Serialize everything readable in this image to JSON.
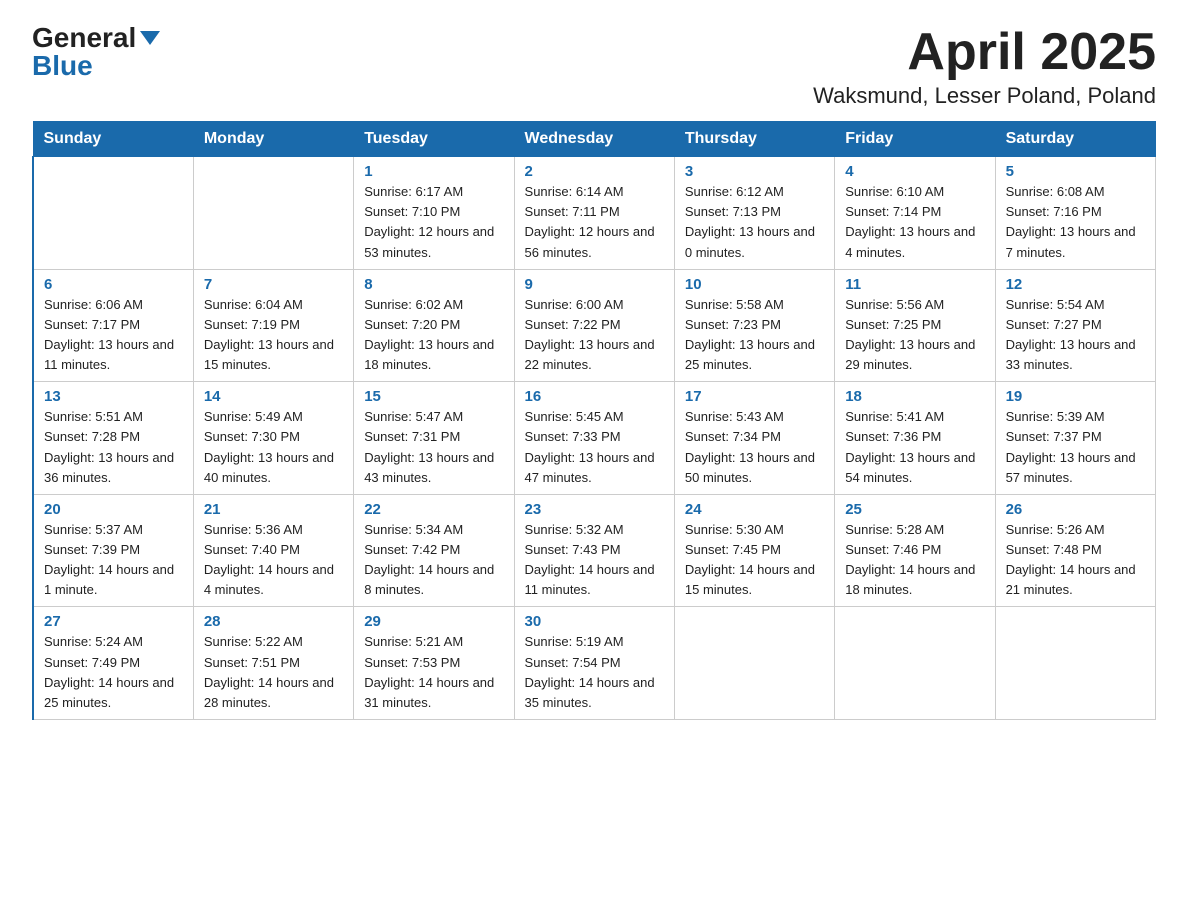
{
  "header": {
    "logo_general": "General",
    "logo_blue": "Blue",
    "title": "April 2025",
    "subtitle": "Waksmund, Lesser Poland, Poland"
  },
  "days_of_week": [
    "Sunday",
    "Monday",
    "Tuesday",
    "Wednesday",
    "Thursday",
    "Friday",
    "Saturday"
  ],
  "weeks": [
    [
      {
        "day": "",
        "sunrise": "",
        "sunset": "",
        "daylight": ""
      },
      {
        "day": "",
        "sunrise": "",
        "sunset": "",
        "daylight": ""
      },
      {
        "day": "1",
        "sunrise": "Sunrise: 6:17 AM",
        "sunset": "Sunset: 7:10 PM",
        "daylight": "Daylight: 12 hours and 53 minutes."
      },
      {
        "day": "2",
        "sunrise": "Sunrise: 6:14 AM",
        "sunset": "Sunset: 7:11 PM",
        "daylight": "Daylight: 12 hours and 56 minutes."
      },
      {
        "day": "3",
        "sunrise": "Sunrise: 6:12 AM",
        "sunset": "Sunset: 7:13 PM",
        "daylight": "Daylight: 13 hours and 0 minutes."
      },
      {
        "day": "4",
        "sunrise": "Sunrise: 6:10 AM",
        "sunset": "Sunset: 7:14 PM",
        "daylight": "Daylight: 13 hours and 4 minutes."
      },
      {
        "day": "5",
        "sunrise": "Sunrise: 6:08 AM",
        "sunset": "Sunset: 7:16 PM",
        "daylight": "Daylight: 13 hours and 7 minutes."
      }
    ],
    [
      {
        "day": "6",
        "sunrise": "Sunrise: 6:06 AM",
        "sunset": "Sunset: 7:17 PM",
        "daylight": "Daylight: 13 hours and 11 minutes."
      },
      {
        "day": "7",
        "sunrise": "Sunrise: 6:04 AM",
        "sunset": "Sunset: 7:19 PM",
        "daylight": "Daylight: 13 hours and 15 minutes."
      },
      {
        "day": "8",
        "sunrise": "Sunrise: 6:02 AM",
        "sunset": "Sunset: 7:20 PM",
        "daylight": "Daylight: 13 hours and 18 minutes."
      },
      {
        "day": "9",
        "sunrise": "Sunrise: 6:00 AM",
        "sunset": "Sunset: 7:22 PM",
        "daylight": "Daylight: 13 hours and 22 minutes."
      },
      {
        "day": "10",
        "sunrise": "Sunrise: 5:58 AM",
        "sunset": "Sunset: 7:23 PM",
        "daylight": "Daylight: 13 hours and 25 minutes."
      },
      {
        "day": "11",
        "sunrise": "Sunrise: 5:56 AM",
        "sunset": "Sunset: 7:25 PM",
        "daylight": "Daylight: 13 hours and 29 minutes."
      },
      {
        "day": "12",
        "sunrise": "Sunrise: 5:54 AM",
        "sunset": "Sunset: 7:27 PM",
        "daylight": "Daylight: 13 hours and 33 minutes."
      }
    ],
    [
      {
        "day": "13",
        "sunrise": "Sunrise: 5:51 AM",
        "sunset": "Sunset: 7:28 PM",
        "daylight": "Daylight: 13 hours and 36 minutes."
      },
      {
        "day": "14",
        "sunrise": "Sunrise: 5:49 AM",
        "sunset": "Sunset: 7:30 PM",
        "daylight": "Daylight: 13 hours and 40 minutes."
      },
      {
        "day": "15",
        "sunrise": "Sunrise: 5:47 AM",
        "sunset": "Sunset: 7:31 PM",
        "daylight": "Daylight: 13 hours and 43 minutes."
      },
      {
        "day": "16",
        "sunrise": "Sunrise: 5:45 AM",
        "sunset": "Sunset: 7:33 PM",
        "daylight": "Daylight: 13 hours and 47 minutes."
      },
      {
        "day": "17",
        "sunrise": "Sunrise: 5:43 AM",
        "sunset": "Sunset: 7:34 PM",
        "daylight": "Daylight: 13 hours and 50 minutes."
      },
      {
        "day": "18",
        "sunrise": "Sunrise: 5:41 AM",
        "sunset": "Sunset: 7:36 PM",
        "daylight": "Daylight: 13 hours and 54 minutes."
      },
      {
        "day": "19",
        "sunrise": "Sunrise: 5:39 AM",
        "sunset": "Sunset: 7:37 PM",
        "daylight": "Daylight: 13 hours and 57 minutes."
      }
    ],
    [
      {
        "day": "20",
        "sunrise": "Sunrise: 5:37 AM",
        "sunset": "Sunset: 7:39 PM",
        "daylight": "Daylight: 14 hours and 1 minute."
      },
      {
        "day": "21",
        "sunrise": "Sunrise: 5:36 AM",
        "sunset": "Sunset: 7:40 PM",
        "daylight": "Daylight: 14 hours and 4 minutes."
      },
      {
        "day": "22",
        "sunrise": "Sunrise: 5:34 AM",
        "sunset": "Sunset: 7:42 PM",
        "daylight": "Daylight: 14 hours and 8 minutes."
      },
      {
        "day": "23",
        "sunrise": "Sunrise: 5:32 AM",
        "sunset": "Sunset: 7:43 PM",
        "daylight": "Daylight: 14 hours and 11 minutes."
      },
      {
        "day": "24",
        "sunrise": "Sunrise: 5:30 AM",
        "sunset": "Sunset: 7:45 PM",
        "daylight": "Daylight: 14 hours and 15 minutes."
      },
      {
        "day": "25",
        "sunrise": "Sunrise: 5:28 AM",
        "sunset": "Sunset: 7:46 PM",
        "daylight": "Daylight: 14 hours and 18 minutes."
      },
      {
        "day": "26",
        "sunrise": "Sunrise: 5:26 AM",
        "sunset": "Sunset: 7:48 PM",
        "daylight": "Daylight: 14 hours and 21 minutes."
      }
    ],
    [
      {
        "day": "27",
        "sunrise": "Sunrise: 5:24 AM",
        "sunset": "Sunset: 7:49 PM",
        "daylight": "Daylight: 14 hours and 25 minutes."
      },
      {
        "day": "28",
        "sunrise": "Sunrise: 5:22 AM",
        "sunset": "Sunset: 7:51 PM",
        "daylight": "Daylight: 14 hours and 28 minutes."
      },
      {
        "day": "29",
        "sunrise": "Sunrise: 5:21 AM",
        "sunset": "Sunset: 7:53 PM",
        "daylight": "Daylight: 14 hours and 31 minutes."
      },
      {
        "day": "30",
        "sunrise": "Sunrise: 5:19 AM",
        "sunset": "Sunset: 7:54 PM",
        "daylight": "Daylight: 14 hours and 35 minutes."
      },
      {
        "day": "",
        "sunrise": "",
        "sunset": "",
        "daylight": ""
      },
      {
        "day": "",
        "sunrise": "",
        "sunset": "",
        "daylight": ""
      },
      {
        "day": "",
        "sunrise": "",
        "sunset": "",
        "daylight": ""
      }
    ]
  ]
}
